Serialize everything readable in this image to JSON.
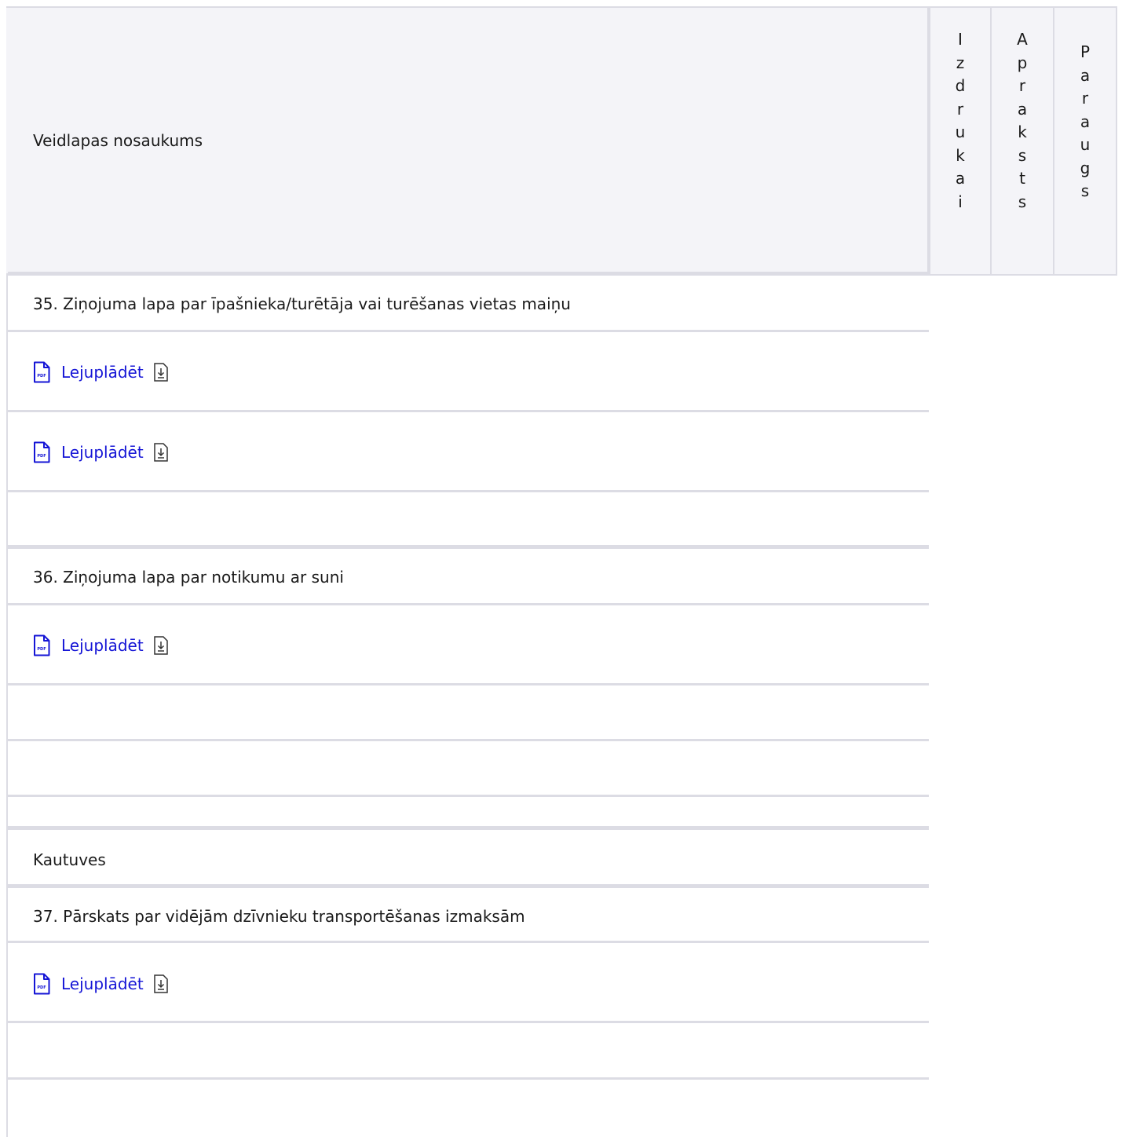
{
  "header": {
    "title": "Veidlapas nosaukums",
    "columns": [
      "Izdrukai",
      "Apraksts",
      "Paraugs"
    ]
  },
  "rows": [
    {
      "type": "text",
      "text": "35. Ziņojuma lapa par īpašnieka/turētāja vai turēšanas vietas maiņu"
    },
    {
      "type": "link",
      "link_text": "Lejuplādēt",
      "icon": "pdf-file-icon"
    },
    {
      "type": "link",
      "link_text": "Lejuplādēt",
      "icon": "pdf-file-icon"
    },
    {
      "type": "empty"
    },
    {
      "type": "text",
      "text": "36. Ziņojuma lapa par notikumu ar suni"
    },
    {
      "type": "link",
      "link_text": "Lejuplādēt",
      "icon": "pdf-file-icon"
    },
    {
      "type": "empty"
    },
    {
      "type": "empty"
    },
    {
      "type": "empty"
    },
    {
      "type": "text",
      "text": "Kautuves"
    },
    {
      "type": "text",
      "text": "37. Pārskats par vidējām dzīvnieku transportēšanas izmaksām"
    },
    {
      "type": "link",
      "link_text": "Lejuplādēt",
      "icon": "pdf-file-icon"
    },
    {
      "type": "empty"
    },
    {
      "type": "empty"
    }
  ],
  "colors": {
    "border": "#dcdce4",
    "header_bg": "#f4f4f8",
    "link": "#1515d6"
  }
}
